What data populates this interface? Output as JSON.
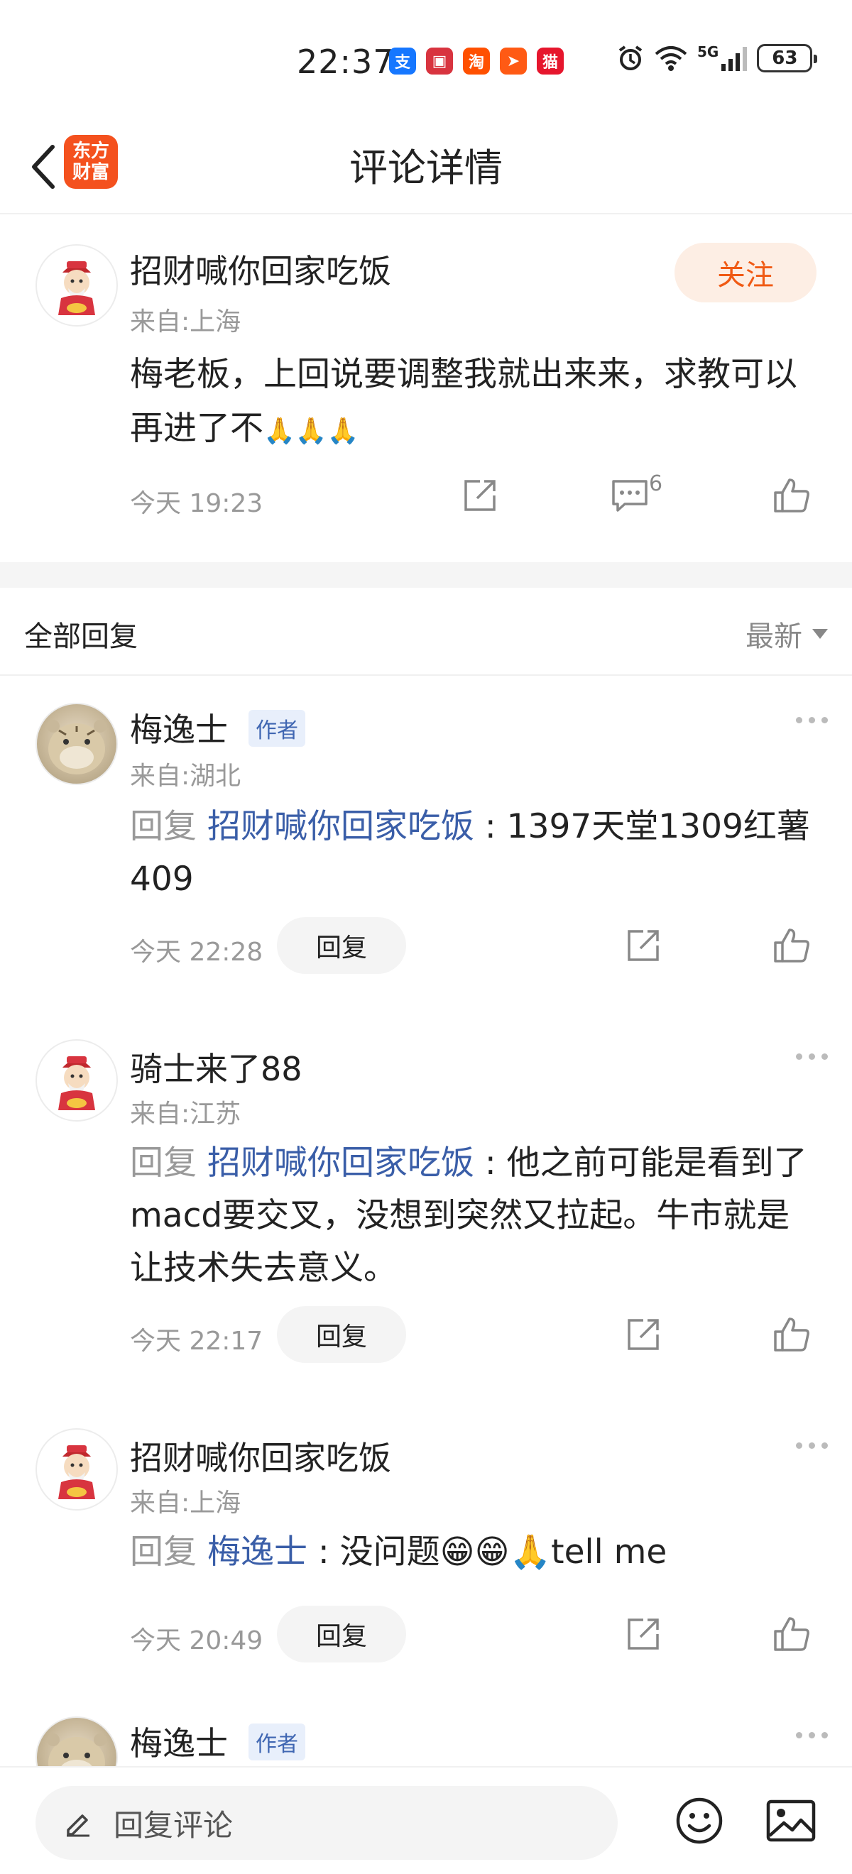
{
  "status_bar": {
    "time": "22:37",
    "apps": [
      {
        "name": "alipay-icon",
        "glyph": "支",
        "color": "#1677ff"
      },
      {
        "name": "huawei-store-icon",
        "glyph": "▣",
        "color": "#d8343f"
      },
      {
        "name": "taobao-icon",
        "glyph": "淘",
        "color": "#ff5000"
      },
      {
        "name": "send-app-icon",
        "glyph": "➤",
        "color": "#ff5a14"
      },
      {
        "name": "tmall-icon",
        "glyph": "猫",
        "color": "#e6162d"
      }
    ],
    "battery": "63",
    "signal_label": "5G"
  },
  "nav": {
    "logo_line1": "东方",
    "logo_line2": "财富",
    "title": "评论详情"
  },
  "main_comment": {
    "username": "招财喊你回家吃饭",
    "location": "来自:上海",
    "follow_label": "关注",
    "text": "梅老板，上回说要调整我就出来来，求教可以再进了不",
    "claps": "🙏🙏🙏",
    "time": "今天 19:23",
    "comment_count": "6"
  },
  "replies_header": {
    "title": "全部回复",
    "sort_label": "最新"
  },
  "replies": [
    {
      "username": "梅逸士",
      "author_tag": "作者",
      "location": "来自:湖北",
      "reply_prefix": "回复",
      "mention": "招财喊你回家吃饭",
      "separator": " : ",
      "text": "1397天堂1309红薯409",
      "time": "今天 22:28",
      "reply_button": "回复"
    },
    {
      "username": "骑士来了88",
      "location": "来自:江苏",
      "reply_prefix": "回复",
      "mention": "招财喊你回家吃饭",
      "separator": " : ",
      "text": "他之前可能是看到了macd要交叉，没想到突然又拉起。牛市就是让技术失去意义。",
      "time": "今天 22:17",
      "reply_button": "回复"
    },
    {
      "username": "招财喊你回家吃饭",
      "location": "来自:上海",
      "reply_prefix": "回复",
      "mention": "梅逸士",
      "separator": " : ",
      "text": "没问题😁😁🙏tell me",
      "time": "今天 20:49",
      "reply_button": "回复"
    },
    {
      "username": "梅逸士",
      "author_tag": "作者"
    }
  ],
  "bottom_bar": {
    "input_placeholder": "回复评论"
  },
  "colors": {
    "brand_orange": "#f4511e",
    "follow_text": "#f05a14",
    "mention_blue": "#3a5ea8"
  }
}
